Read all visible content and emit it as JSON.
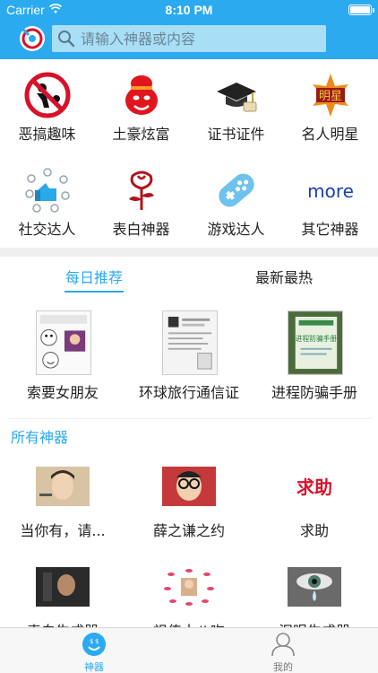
{
  "status_bar": {
    "carrier": "Carrier",
    "time": "8:10 PM"
  },
  "search": {
    "placeholder": "请输入神器或内容"
  },
  "categories": [
    {
      "label": "恶搞趣味",
      "icon": "prohibited-spitting-icon"
    },
    {
      "label": "土豪炫富",
      "icon": "red-face-icon"
    },
    {
      "label": "证书证件",
      "icon": "graduation-cap-icon"
    },
    {
      "label": "名人明星",
      "icon": "star-badge-icon",
      "badge_text": "明星"
    },
    {
      "label": "社交达人",
      "icon": "social-network-icon"
    },
    {
      "label": "表白神器",
      "icon": "rose-icon"
    },
    {
      "label": "游戏达人",
      "icon": "gamepad-icon"
    },
    {
      "label": "其它神器",
      "icon": "more-icon",
      "icon_text": "more"
    }
  ],
  "tabs": [
    {
      "label": "每日推荐",
      "active": true
    },
    {
      "label": "最新最热",
      "active": false
    }
  ],
  "featured": [
    {
      "label": "索要女朋友"
    },
    {
      "label": "环球旅行通信证"
    },
    {
      "label": "进程防骗手册",
      "thumb_text": "进程防骗手册"
    }
  ],
  "section": {
    "title": "所有神器"
  },
  "tools": [
    {
      "label": "当你有，请..."
    },
    {
      "label": "薛之谦之约"
    },
    {
      "label": "求助",
      "thumb_text": "求助"
    },
    {
      "label": "表白生成器"
    },
    {
      "label": "祖传十八吻"
    },
    {
      "label": "泪眼生成器"
    }
  ],
  "tab_bar": [
    {
      "label": "神器",
      "active": true
    },
    {
      "label": "我的",
      "active": false
    }
  ],
  "colors": {
    "accent": "#2baaf0",
    "header": "#2baaf0",
    "search_bg": "#a8dff7",
    "red": "#d8102a"
  }
}
